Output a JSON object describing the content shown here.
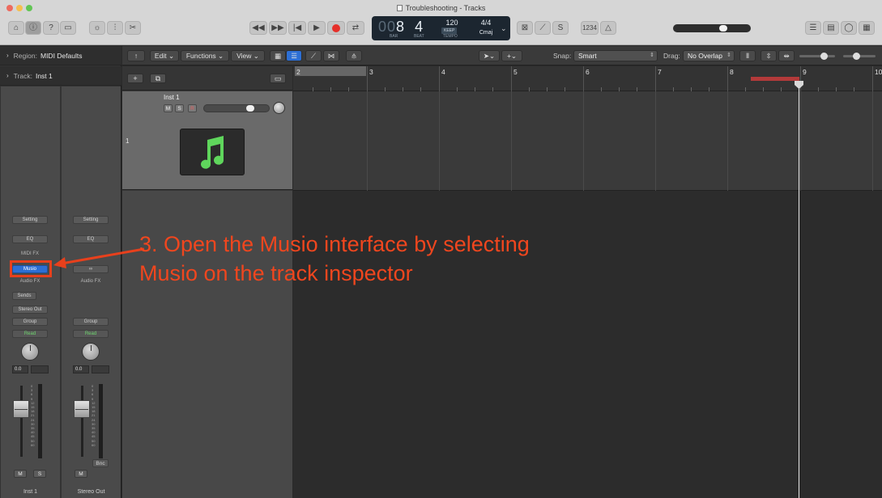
{
  "window": {
    "title": "Troubleshooting - Tracks"
  },
  "lcd": {
    "bar": "8",
    "bar_prefix": "00",
    "beat": "4",
    "bar_label": "BAR",
    "beat_label": "BEAT",
    "tempo": "120",
    "keep_label": "KEEP",
    "tempo_label": "TEMPO",
    "time_signature": "4/4",
    "key": "Cmaj"
  },
  "toolbar": {
    "count_in": "1234"
  },
  "inspector": {
    "region_label": "Region:",
    "region_value": "MIDI Defaults",
    "track_label": "Track:",
    "track_value": "Inst 1"
  },
  "strip1": {
    "setting": "Setting",
    "eq": "EQ",
    "midi_fx": "MIDI FX",
    "instrument": "Musio",
    "audio_fx": "Audio FX",
    "sends": "Sends",
    "output": "Stereo Out",
    "group": "Group",
    "automation": "Read",
    "volume": "0.0",
    "mute": "M",
    "solo": "S",
    "name": "Inst 1"
  },
  "strip2": {
    "setting": "Setting",
    "eq": "EQ",
    "link": "∞",
    "audio_fx": "Audio FX",
    "group": "Group",
    "automation": "Read",
    "volume": "0.0",
    "mute": "M",
    "bounce": "Bnc",
    "name": "Stereo Out"
  },
  "meter_scale": [
    "0",
    "3",
    "6",
    "9",
    "12",
    "15",
    "18",
    "21",
    "24",
    "30",
    "35",
    "40",
    "45",
    "50",
    "60"
  ],
  "tracks_toolbar": {
    "edit": "Edit",
    "functions": "Functions",
    "view": "View",
    "snap_label": "Snap:",
    "snap_value": "Smart",
    "drag_label": "Drag:",
    "drag_value": "No Overlap"
  },
  "track": {
    "number": "1",
    "name": "Inst 1",
    "mute": "M",
    "solo": "S",
    "record": "R"
  },
  "ruler": {
    "bars": [
      "2",
      "3",
      "4",
      "5",
      "6",
      "7",
      "8",
      "9",
      "10"
    ]
  },
  "annotation": {
    "line1": "3. Open the Musio interface by selecting",
    "line2": "Musio on the track inspector"
  },
  "colors": {
    "accent": "#2d6fd4",
    "annotation": "#f0461e",
    "record": "#e5302a",
    "icon_green": "#5fd65c"
  }
}
